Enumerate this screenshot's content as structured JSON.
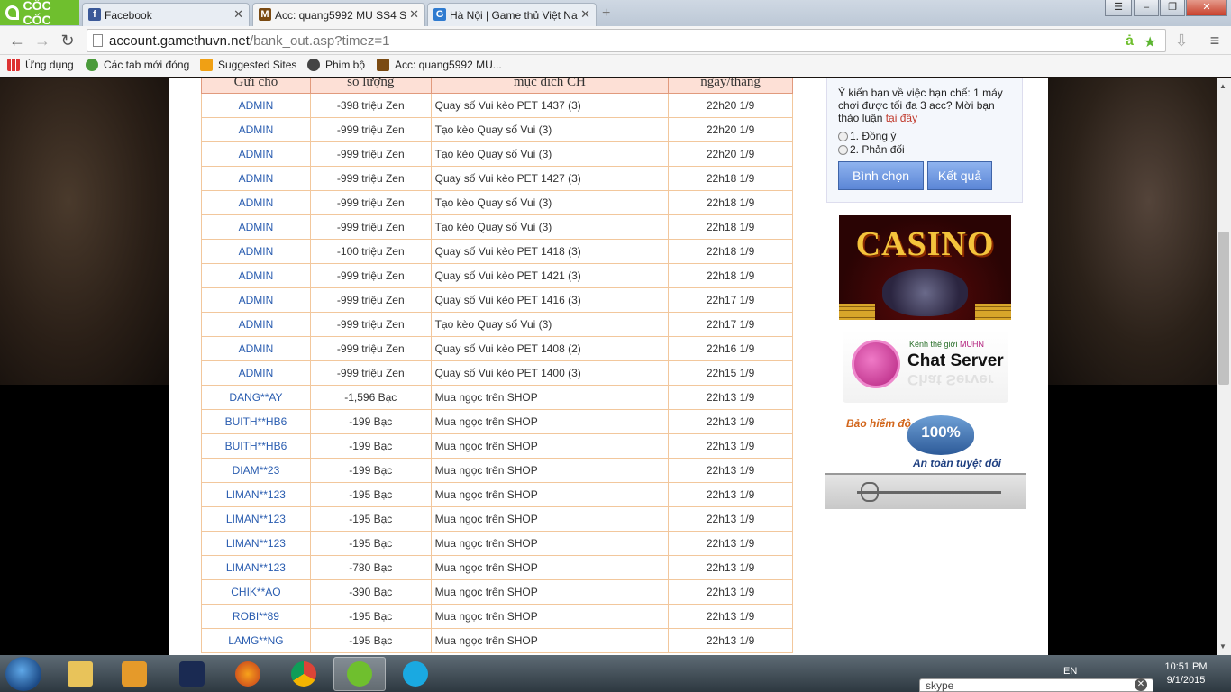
{
  "browser": {
    "brand": "CỐC CỐC",
    "tabs": [
      {
        "title": "Facebook",
        "icon": "facebook-icon"
      },
      {
        "title": "Acc: quang5992 MU SS4 S",
        "icon": "mu-icon"
      },
      {
        "title": "Hà Nội | Game thủ Việt Na",
        "icon": "gamethuvn-icon"
      }
    ],
    "url_host": "account.gamethuvn.net",
    "url_path": "/bank_out.asp?timez=1",
    "bookmarks": [
      "Ứng dụng",
      "Các tab mới đóng",
      "Suggested Sites",
      "Phim bộ",
      "Acc: quang5992 MU..."
    ]
  },
  "table": {
    "headers": [
      "Gửi cho",
      "số lượng",
      "mục đích CH",
      "ngày/tháng"
    ],
    "rows": [
      {
        "to": "ADMIN",
        "amount": "-398  triệu Zen",
        "purpose": "Quay số Vui kèo PET 1437 (3)",
        "date": "22h20 1/9"
      },
      {
        "to": "ADMIN",
        "amount": "-999  triệu Zen",
        "purpose": "Tạo kèo Quay số Vui (3)",
        "date": "22h20 1/9"
      },
      {
        "to": "ADMIN",
        "amount": "-999  triệu Zen",
        "purpose": "Tạo kèo Quay số Vui (3)",
        "date": "22h20 1/9"
      },
      {
        "to": "ADMIN",
        "amount": "-999  triệu Zen",
        "purpose": "Quay số Vui kèo PET 1427 (3)",
        "date": "22h18 1/9"
      },
      {
        "to": "ADMIN",
        "amount": "-999  triệu Zen",
        "purpose": "Tạo kèo Quay số Vui (3)",
        "date": "22h18 1/9"
      },
      {
        "to": "ADMIN",
        "amount": "-999  triệu Zen",
        "purpose": "Tạo kèo Quay số Vui (3)",
        "date": "22h18 1/9"
      },
      {
        "to": "ADMIN",
        "amount": "-100  triệu Zen",
        "purpose": "Quay số Vui kèo PET 1418 (3)",
        "date": "22h18 1/9"
      },
      {
        "to": "ADMIN",
        "amount": "-999  triệu Zen",
        "purpose": "Quay số Vui kèo PET 1421 (3)",
        "date": "22h18 1/9"
      },
      {
        "to": "ADMIN",
        "amount": "-999  triệu Zen",
        "purpose": "Quay số Vui kèo PET 1416 (3)",
        "date": "22h17 1/9"
      },
      {
        "to": "ADMIN",
        "amount": "-999  triệu Zen",
        "purpose": "Tạo kèo Quay số Vui (3)",
        "date": "22h17 1/9"
      },
      {
        "to": "ADMIN",
        "amount": "-999  triệu Zen",
        "purpose": "Quay số Vui kèo PET 1408 (2)",
        "date": "22h16 1/9"
      },
      {
        "to": "ADMIN",
        "amount": "-999  triệu Zen",
        "purpose": "Quay số Vui kèo PET 1400 (3)",
        "date": "22h15 1/9"
      },
      {
        "to": "DANG**AY",
        "amount": "-1,596  Bạc",
        "purpose": "Mua ngọc trên SHOP",
        "date": "22h13 1/9"
      },
      {
        "to": "BUITH**HB6",
        "amount": "-199  Bạc",
        "purpose": "Mua ngọc trên SHOP",
        "date": "22h13 1/9"
      },
      {
        "to": "BUITH**HB6",
        "amount": "-199  Bạc",
        "purpose": "Mua ngọc trên SHOP",
        "date": "22h13 1/9"
      },
      {
        "to": "DIAM**23",
        "amount": "-199  Bạc",
        "purpose": "Mua ngọc trên SHOP",
        "date": "22h13 1/9"
      },
      {
        "to": "LIMAN**123",
        "amount": "-195  Bạc",
        "purpose": "Mua ngọc trên SHOP",
        "date": "22h13 1/9"
      },
      {
        "to": "LIMAN**123",
        "amount": "-195  Bạc",
        "purpose": "Mua ngọc trên SHOP",
        "date": "22h13 1/9"
      },
      {
        "to": "LIMAN**123",
        "amount": "-195  Bạc",
        "purpose": "Mua ngọc trên SHOP",
        "date": "22h13 1/9"
      },
      {
        "to": "LIMAN**123",
        "amount": "-780  Bạc",
        "purpose": "Mua ngọc trên SHOP",
        "date": "22h13 1/9"
      },
      {
        "to": "CHIK**AO",
        "amount": "-390  Bạc",
        "purpose": "Mua ngọc trên SHOP",
        "date": "22h13 1/9"
      },
      {
        "to": "ROBI**89",
        "amount": "-195  Bạc",
        "purpose": "Mua ngọc trên SHOP",
        "date": "22h13 1/9"
      },
      {
        "to": "LAMG**NG",
        "amount": "-195  Bạc",
        "purpose": "Mua ngọc trên SHOP",
        "date": "22h13 1/9"
      }
    ]
  },
  "poll": {
    "question": "Ý kiến bạn về việc hạn chế: 1 máy chơi được tối đa 3 acc? Mời bạn thảo luận ",
    "link": "tại đây",
    "options": [
      "1. Đồng ý",
      "2. Phản đối"
    ],
    "vote_label": "Bình chọn",
    "result_label": "Kết quả"
  },
  "banners": {
    "casino": "CASINO",
    "chat_small_prefix": "Kênh thế giới ",
    "chat_small_brand": "MUHN",
    "chat_title": "Chat Server",
    "insure_top": "Bảo hiểm độ",
    "insure_seal": "100%",
    "insure_bottom": "An toàn tuyệt đối"
  },
  "taskbar": {
    "lang": "EN",
    "time": "10:51 PM",
    "date": "9/1/2015",
    "skype_label": "skype"
  }
}
